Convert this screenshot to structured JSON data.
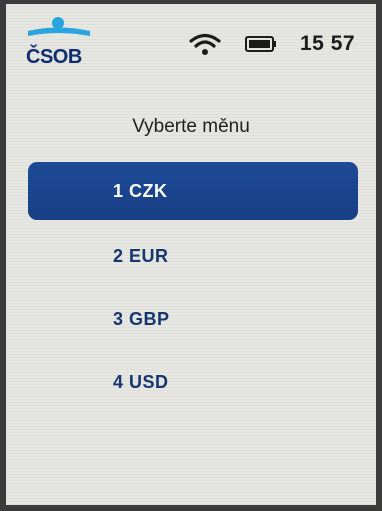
{
  "status_bar": {
    "logo_text": "ČSOB",
    "time": "15 57",
    "icons": [
      "wifi-icon",
      "battery-icon"
    ]
  },
  "prompt": "Vyberte měnu",
  "currencies": [
    {
      "label": "1 CZK",
      "selected": true
    },
    {
      "label": "2 EUR",
      "selected": false
    },
    {
      "label": "3 GBP",
      "selected": false
    },
    {
      "label": "4 USD",
      "selected": false
    }
  ],
  "colors": {
    "brand_blue": "#173f85",
    "logo_light_blue": "#2aa4df",
    "text_dark": "#1f1f1f",
    "screen_bg": "#e6e6e3"
  }
}
